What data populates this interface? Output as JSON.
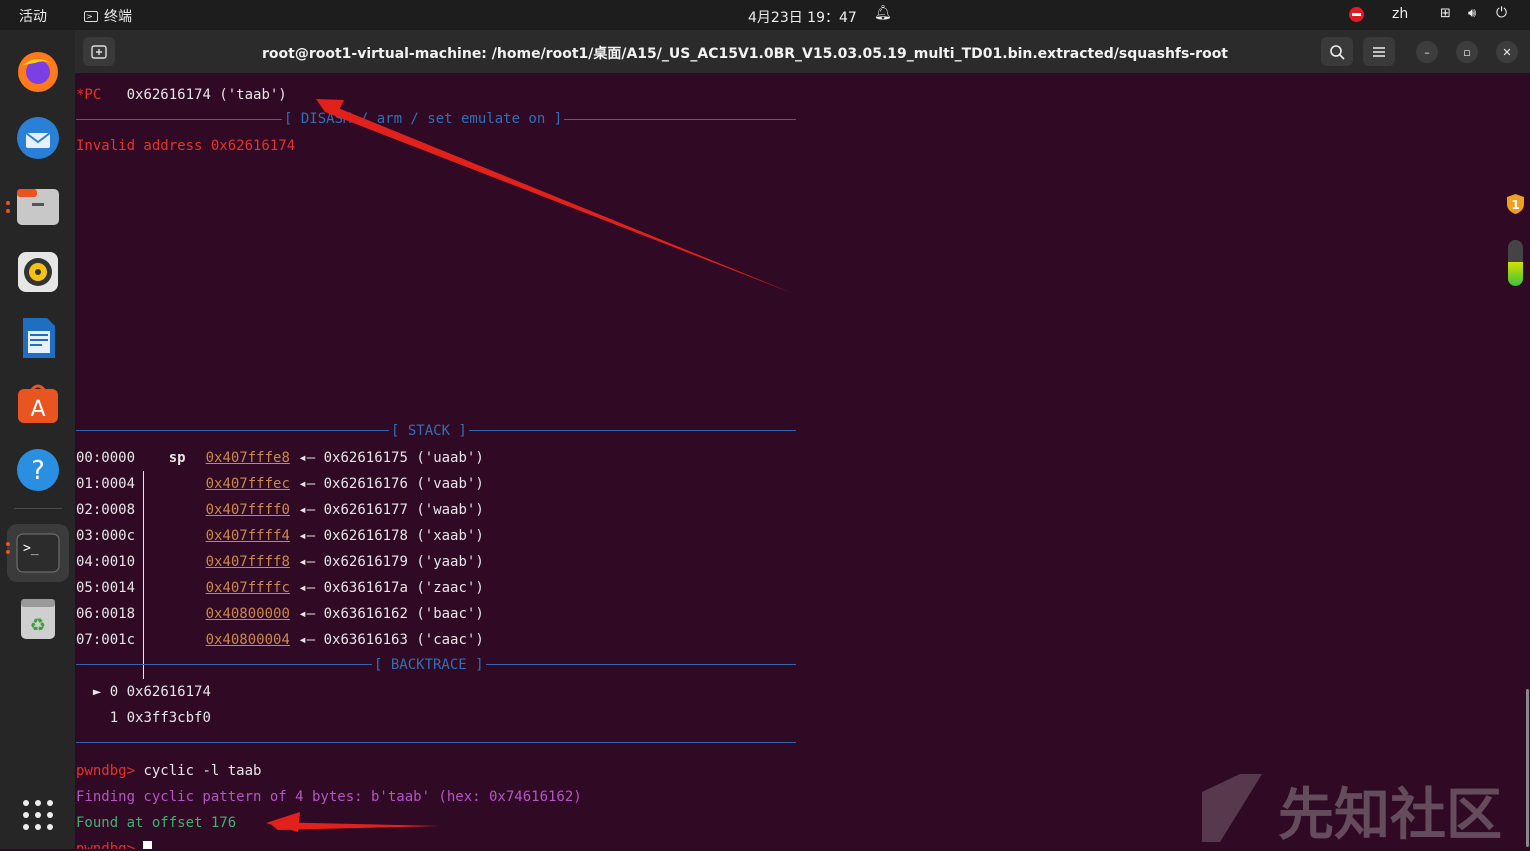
{
  "topbar": {
    "activities": "活动",
    "app_name": "终端",
    "clock": "4月23日 19：47",
    "language": "zh"
  },
  "dock": {
    "items": [
      "firefox-icon",
      "thunderbird-icon",
      "files-icon",
      "rhythmbox-icon",
      "libreoffice-writer-icon",
      "app-center-icon",
      "help-icon",
      "terminal-icon",
      "trash-icon",
      "show-apps-icon"
    ]
  },
  "window": {
    "title": "root@root1-virtual-machine: /home/root1/桌面/A15/_US_AC15V1.0BR_V15.03.05.19_multi_TD01.bin.extracted/squashfs-root"
  },
  "terminal": {
    "pc_label": "*PC",
    "pc_value": "0x62616174 ('taab')",
    "disasm_header": "[ DISASM / arm / set emulate on ]",
    "invalid_address": "Invalid address 0x62616174",
    "stack_header": "[ STACK ]",
    "stack_rows": [
      {
        "idx": "00:0000",
        "reg": "sp",
        "addr": "0x407fffe8",
        "val": "0x62616175 ('uaab')"
      },
      {
        "idx": "01:0004",
        "reg": "",
        "addr": "0x407fffec",
        "val": "0x62616176 ('vaab')"
      },
      {
        "idx": "02:0008",
        "reg": "",
        "addr": "0x407ffff0",
        "val": "0x62616177 ('waab')"
      },
      {
        "idx": "03:000c",
        "reg": "",
        "addr": "0x407ffff4",
        "val": "0x62616178 ('xaab')"
      },
      {
        "idx": "04:0010",
        "reg": "",
        "addr": "0x407ffff8",
        "val": "0x62616179 ('yaab')"
      },
      {
        "idx": "05:0014",
        "reg": "",
        "addr": "0x407ffffc",
        "val": "0x6361617a ('zaac')"
      },
      {
        "idx": "06:0018",
        "reg": "",
        "addr": "0x40800000",
        "val": "0x63616162 ('baac')"
      },
      {
        "idx": "07:001c",
        "reg": "",
        "addr": "0x40800004",
        "val": "0x63616163 ('caac')"
      }
    ],
    "backtrace_header": "[ BACKTRACE ]",
    "backtrace": [
      {
        "marker": "►",
        "frame": "0",
        "addr": "0x62616174"
      },
      {
        "marker": " ",
        "frame": "1",
        "addr": "0x3ff3cbf0"
      }
    ],
    "prompt": "pwndbg>",
    "command": " cyclic -l taab",
    "finding": "Finding cyclic pattern of 4 bytes: b'taab' (hex: 0x74616162)",
    "found": "Found at offset 176",
    "arrow_glyph": "◂—"
  },
  "watermark": "先知社区",
  "notification_badge": "1"
}
